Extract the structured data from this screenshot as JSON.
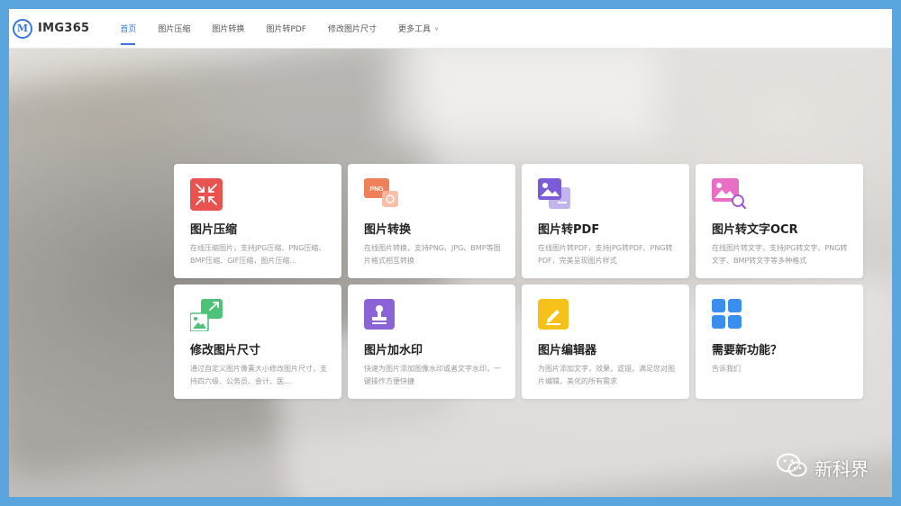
{
  "header": {
    "logo_mark": "M",
    "logo_text": "IMG365",
    "nav": [
      {
        "label": "首页",
        "active": true
      },
      {
        "label": "图片压缩"
      },
      {
        "label": "图片转换"
      },
      {
        "label": "图片转PDF"
      },
      {
        "label": "修改图片尺寸"
      },
      {
        "label": "更多工具"
      }
    ]
  },
  "cards": [
    {
      "title": "图片压缩",
      "desc": "在线压缩图片，支持JPG压缩、PNG压缩、BMP压缩、GIF压缩，图片压缩...",
      "icon": "compress-icon",
      "color": "#e8524f"
    },
    {
      "title": "图片转换",
      "desc": "在线图片转换，支持PNG、JPG、BMP等图片格式相互转换",
      "icon": "png-convert-icon",
      "icon_text": "PNG",
      "color": "#f0805a"
    },
    {
      "title": "图片转PDF",
      "desc": "在线图片转PDF，支持JPG转PDF、PNG转PDF，完美呈现图片样式",
      "icon": "image-pdf-icon",
      "color": "#7b5cd6"
    },
    {
      "title": "图片转文字OCR",
      "desc": "在线图片转文字，支持JPG转文字、PNG转文字、BMP转文字等多种格式",
      "icon": "ocr-icon",
      "color": "#e86fc6"
    },
    {
      "title": "修改图片尺寸",
      "desc": "通过自定义图片像素大小修改图片尺寸，支持四六级、公务员、会计、医...",
      "icon": "resize-icon",
      "color": "#4fc27a"
    },
    {
      "title": "图片加水印",
      "desc": "快速为图片添加图像水印或者文字水印，一键操作方便快捷",
      "icon": "stamp-icon",
      "color": "#8a63d6"
    },
    {
      "title": "图片编辑器",
      "desc": "为图片添加文字，效果，滤镜，满足您对图片编辑，美化的所有需求",
      "icon": "edit-icon",
      "color": "#f6c21a"
    },
    {
      "title": "需要新功能？",
      "desc": "告诉我们",
      "icon": "grid-icon",
      "color": "#3a8ef0"
    }
  ],
  "watermark": {
    "text": "新科界",
    "icon": "wechat-icon"
  }
}
